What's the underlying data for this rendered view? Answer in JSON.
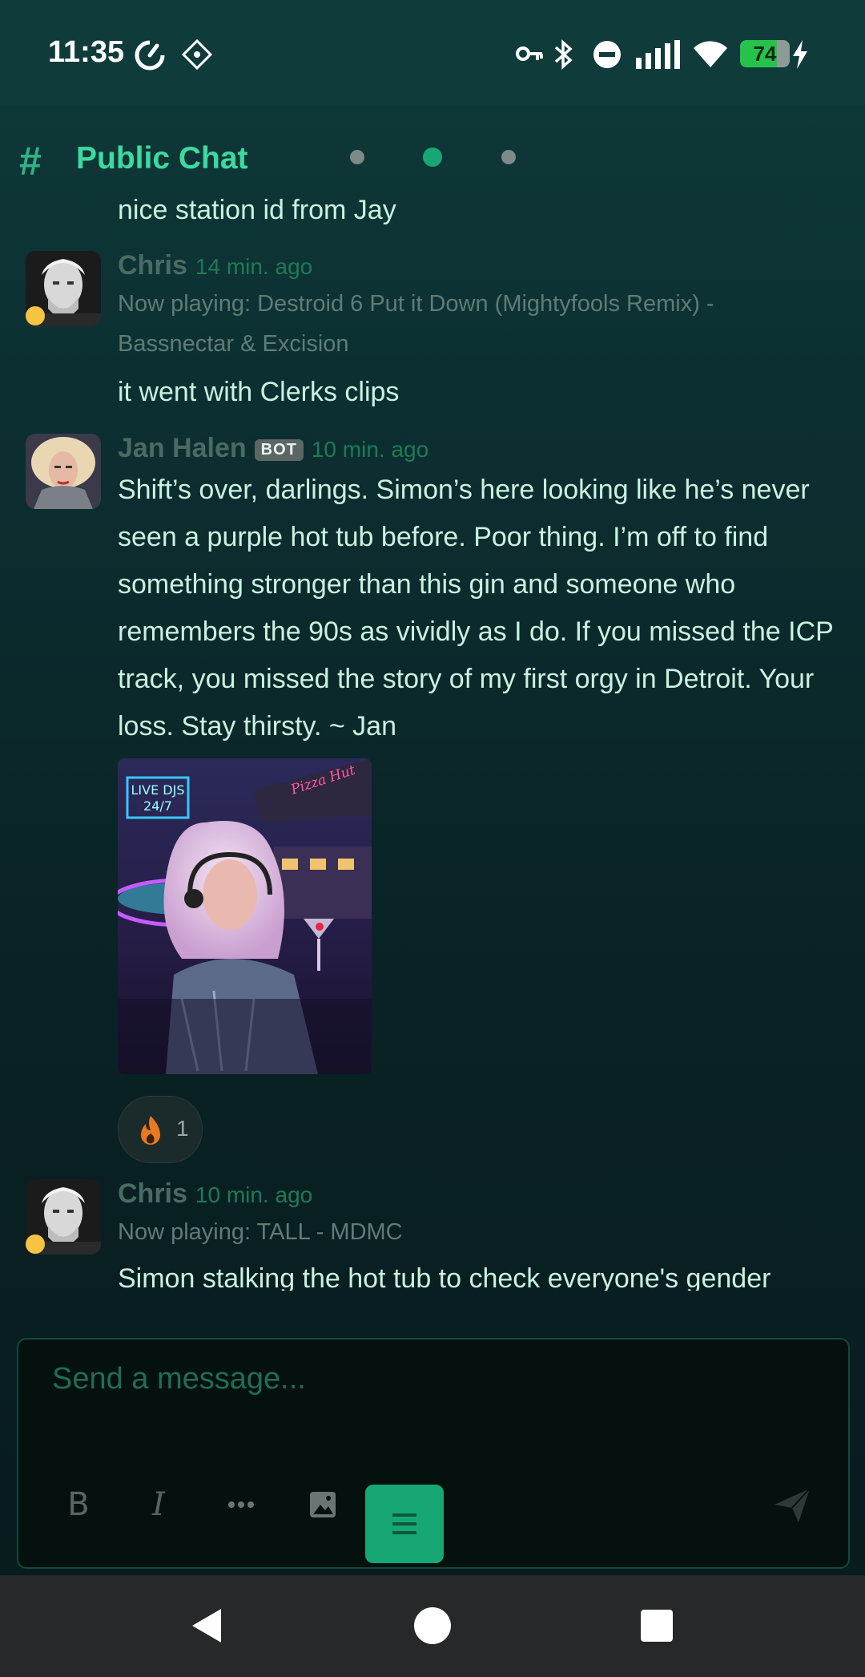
{
  "status_bar": {
    "time": "11:35",
    "battery": "74",
    "battery_level_percent": 74
  },
  "channel": {
    "title": "Public Chat",
    "pages": 3,
    "active_page": 1
  },
  "messages": [
    {
      "text": "nice station id from Jay"
    },
    {
      "author": "Chris",
      "time": "14 min. ago",
      "now_playing": "Now playing: Destroid 6 Put it Down (Mightyfools Remix) - Bassnectar & Excision",
      "text": "it went with Clerks clips"
    },
    {
      "author": "Jan Halen",
      "badge": "BOT",
      "time": "10 min. ago",
      "text": "Shift’s over, darlings. Simon’s here looking like he’s never seen a purple hot tub before. Poor thing. I’m off to find something stronger than this gin and someone who remembers the 90s as vividly as I do. If you missed the ICP track, you missed the story of my first orgy in Detroit. Your loss. Stay thirsty. ~ Jan",
      "attachment": {
        "neon_sign_1": "LIVE DJS",
        "neon_sign_2": "24/7",
        "sign_right": "Pizza Hut"
      },
      "reaction": {
        "icon": "fire-icon",
        "count": "1"
      }
    },
    {
      "author": "Chris",
      "time": "10 min. ago",
      "now_playing": "Now playing: TALL - MDMC",
      "text": "Simon stalking the hot tub to check everyone's gender"
    }
  ],
  "composer": {
    "placeholder": "Send a message...",
    "tools": [
      "bold-icon",
      "italic-icon",
      "more-icon",
      "image-icon",
      "menu-icon",
      "send-icon"
    ]
  },
  "colors": {
    "accent": "#3dd9a0",
    "active_button": "#17a774",
    "status_away": "#f5c542"
  }
}
